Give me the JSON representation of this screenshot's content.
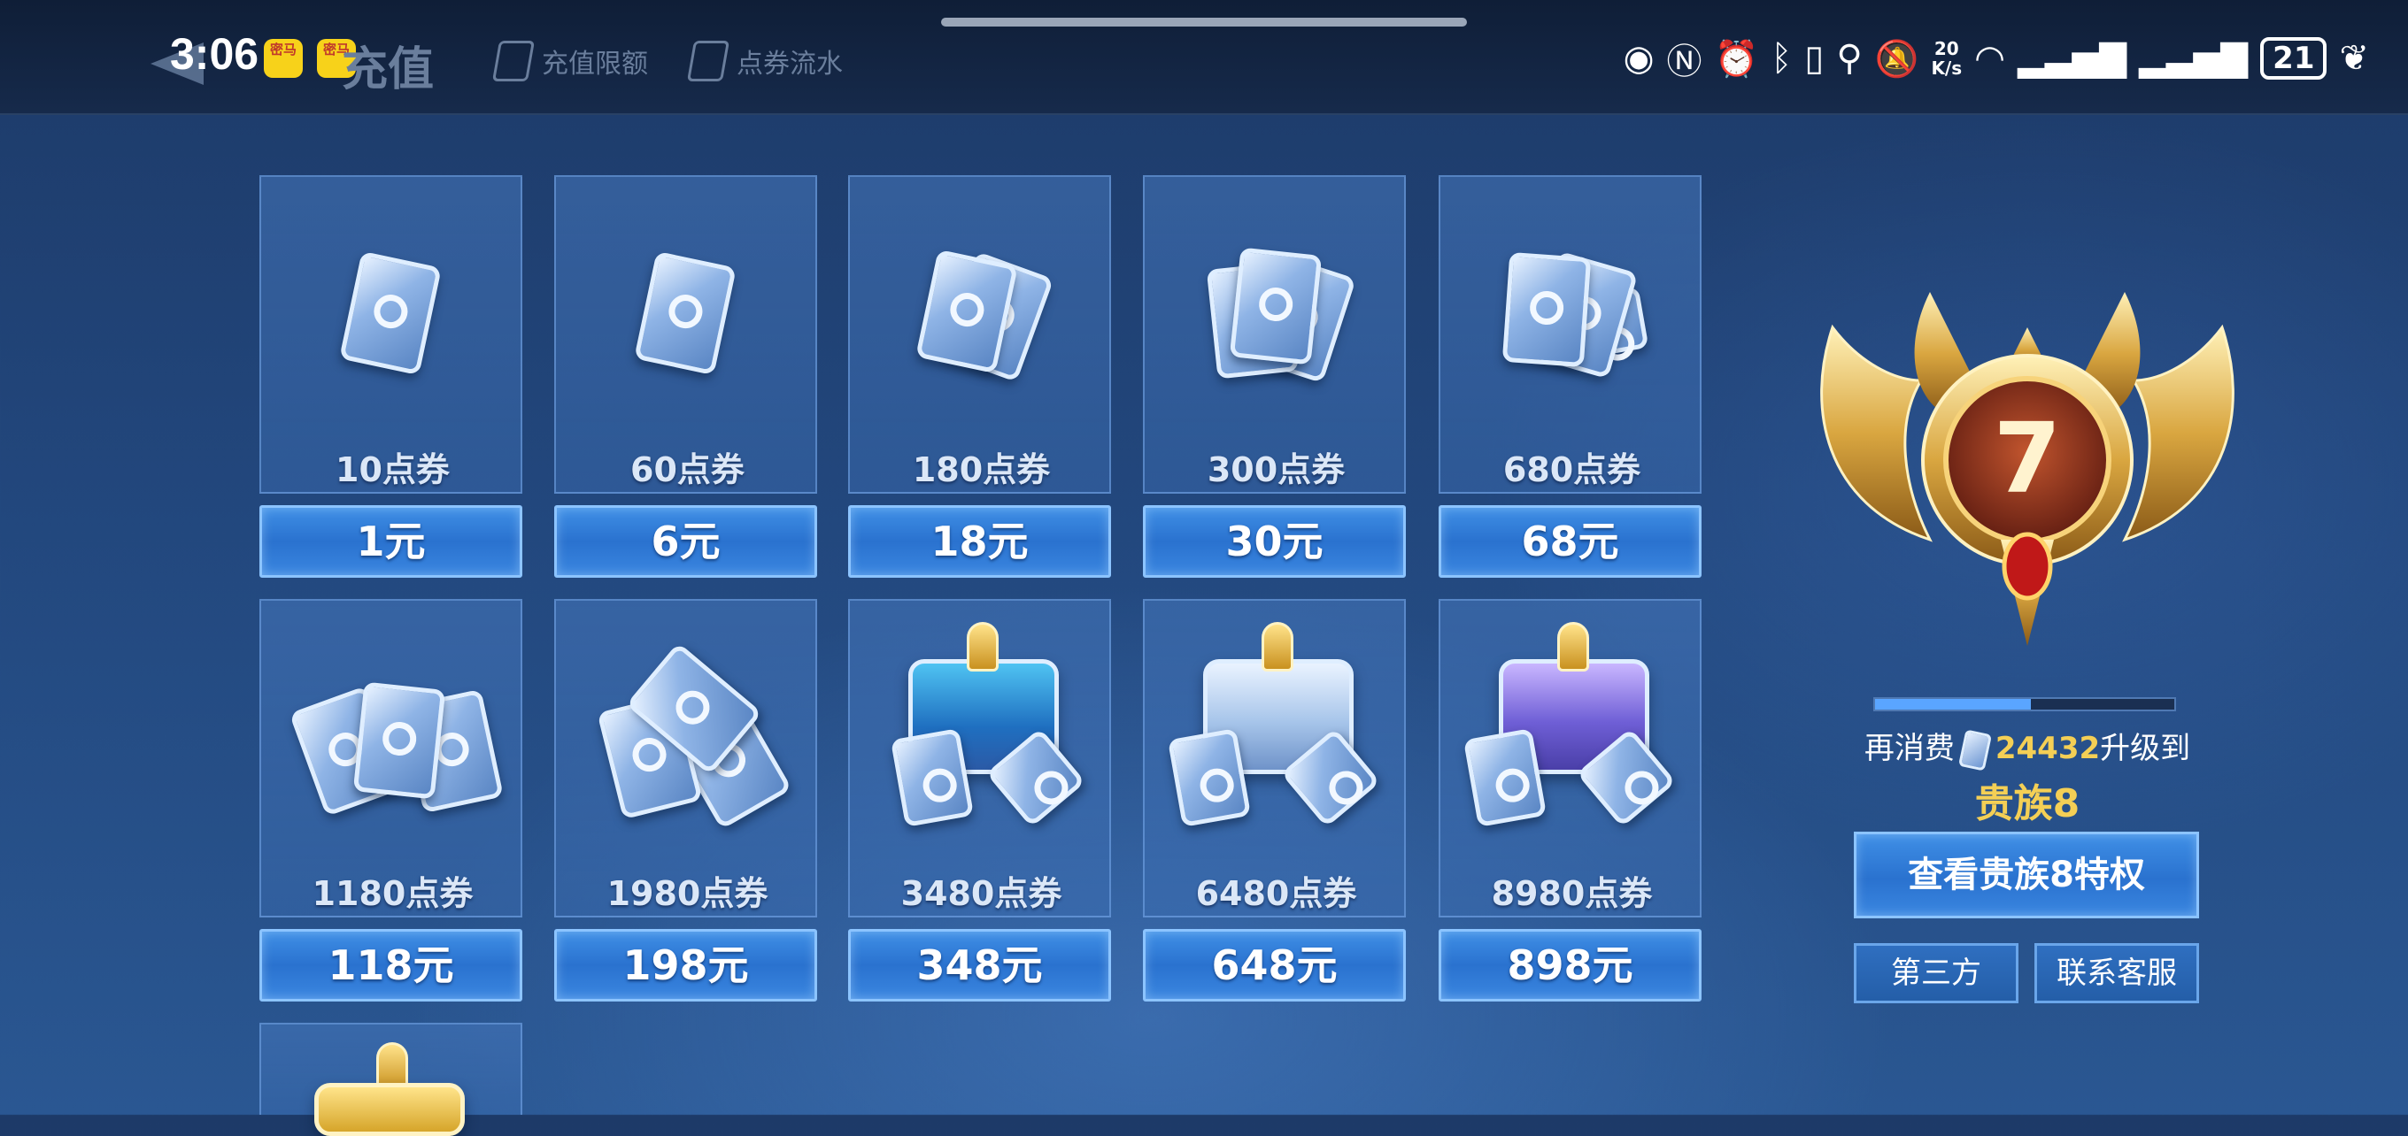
{
  "status_bar": {
    "time": "3:06",
    "app_badge_text": "密马",
    "net_speed_value": "20",
    "net_speed_unit": "K/s",
    "battery": "21"
  },
  "header": {
    "title": "充值",
    "tabs": [
      {
        "label": "充值限额",
        "icon": "card-icon"
      },
      {
        "label": "点券流水",
        "icon": "ledger-icon"
      }
    ]
  },
  "packages": [
    {
      "amount": "10点券",
      "price": "1元",
      "art": "ticket-1"
    },
    {
      "amount": "60点券",
      "price": "6元",
      "art": "ticket-1"
    },
    {
      "amount": "180点券",
      "price": "18元",
      "art": "ticket-2"
    },
    {
      "amount": "300点券",
      "price": "30元",
      "art": "ticket-3"
    },
    {
      "amount": "680点券",
      "price": "68元",
      "art": "ticket-4"
    },
    {
      "amount": "1180点券",
      "price": "118元",
      "art": "ticket-pile"
    },
    {
      "amount": "1980点券",
      "price": "198元",
      "art": "ticket-stack"
    },
    {
      "amount": "3480点券",
      "price": "348元",
      "art": "chest-blue"
    },
    {
      "amount": "6480点券",
      "price": "648元",
      "art": "chest-silver"
    },
    {
      "amount": "8980点券",
      "price": "898元",
      "art": "chest-purple"
    }
  ],
  "noble": {
    "current_level": "7",
    "progress": 0.52,
    "upgrade_prefix": "再消费",
    "remaining": "24432",
    "upgrade_suffix": "升级到",
    "next_level": "贵族8",
    "privilege_button": "查看贵族8特权",
    "third_party_button": "第三方",
    "support_button": "联系客服"
  },
  "colors": {
    "accent_gold": "#f4cf55",
    "button_blue": "#2a72cf",
    "background": "#22477d"
  }
}
